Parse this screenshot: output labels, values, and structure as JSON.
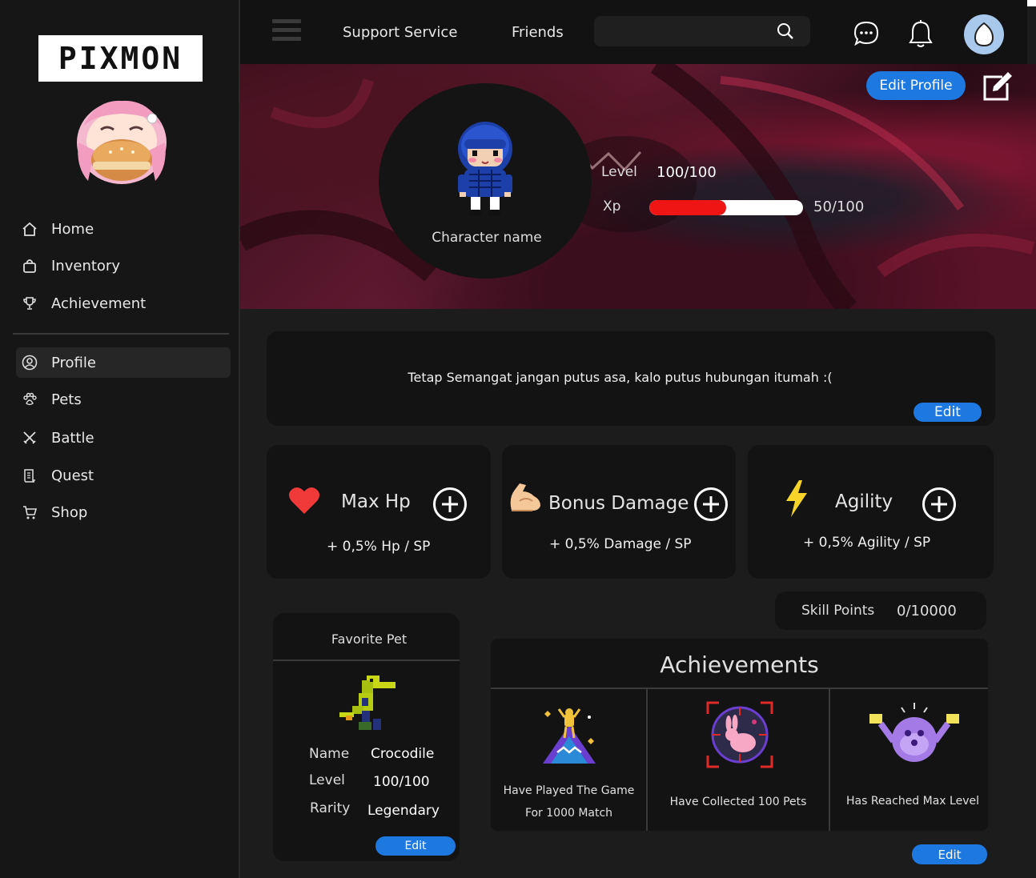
{
  "sidebar": {
    "logo": "PIXMON",
    "nav_main": [
      {
        "label": "Home",
        "icon": "home-icon"
      },
      {
        "label": "Inventory",
        "icon": "bag-icon"
      },
      {
        "label": "Achievement",
        "icon": "trophy-icon"
      }
    ],
    "nav_secondary": [
      {
        "label": "Profile",
        "icon": "user-circle-icon",
        "active": true
      },
      {
        "label": "Pets",
        "icon": "paw-icon"
      },
      {
        "label": "Battle",
        "icon": "crossed-swords-icon"
      },
      {
        "label": "Quest",
        "icon": "scroll-icon"
      },
      {
        "label": "Shop",
        "icon": "cart-icon"
      }
    ]
  },
  "topbar": {
    "links": [
      "Support Service",
      "Friends"
    ],
    "search_value": ""
  },
  "profile": {
    "edit_profile_label": "Edit Profile",
    "character_name": "Character name",
    "level_label": "Level",
    "level_value": "100/100",
    "xp_label": "Xp",
    "xp_value": "50/100",
    "xp_fraction": 0.5
  },
  "motto": {
    "text": "Tetap Semangat jangan putus asa, kalo putus hubungan itumah :(",
    "edit_label": "Edit"
  },
  "stats": [
    {
      "title": "Max Hp",
      "desc": "+ 0,5% Hp / SP",
      "icon": "heart-icon"
    },
    {
      "title": "Bonus Damage",
      "desc": "+ 0,5% Damage / SP",
      "icon": "flexed-bicep-icon"
    },
    {
      "title": "Agility",
      "desc": "+ 0,5% Agility / SP",
      "icon": "lightning-icon"
    }
  ],
  "skill_points": {
    "label": "Skill Points",
    "value": "0/10000"
  },
  "favorite_pet": {
    "title": "Favorite Pet",
    "name_label": "Name",
    "name": "Crocodile",
    "level_label": "Level",
    "level": "100/100",
    "rarity_label": "Rarity",
    "rarity": "Legendary",
    "edit_label": "Edit"
  },
  "achievements": {
    "title": "Achievements",
    "items": [
      {
        "line1": "Have Played The Game",
        "line2": "For 1000 Match",
        "icon": "mountain-summit-icon"
      },
      {
        "line1": "Have Collected 100 Pets",
        "line2": "",
        "icon": "rabbit-target-icon"
      },
      {
        "line1": "Has Reached Max Level",
        "line2": "",
        "icon": "celebrating-creature-icon"
      }
    ],
    "edit_label": "Edit"
  },
  "colors": {
    "accent_blue": "#1d78e0",
    "xp_red": "#f01515",
    "panel": "#131313",
    "background": "#1c1c1c"
  }
}
